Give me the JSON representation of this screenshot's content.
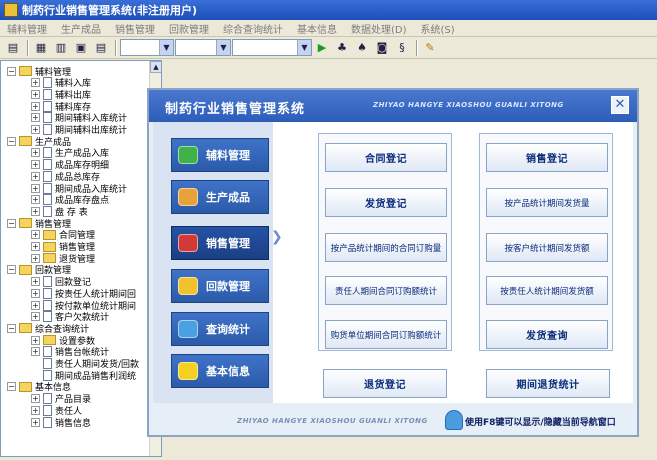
{
  "window": {
    "title": "制药行业销售管理系统(非注册用户)"
  },
  "menu": [
    "辅料管理",
    "生产成品",
    "销售管理",
    "回款管理",
    "综合查询统计",
    "基本信息",
    "数据处理(D)",
    "系统(S)"
  ],
  "tree": [
    {
      "text": "辅料管理",
      "level": 0,
      "kind": "folder",
      "exp": "minus"
    },
    {
      "text": "辅料入库",
      "level": 1,
      "kind": "doc",
      "exp": "plus"
    },
    {
      "text": "辅料出库",
      "level": 1,
      "kind": "doc",
      "exp": "plus"
    },
    {
      "text": "辅料库存",
      "level": 1,
      "kind": "doc",
      "exp": "plus"
    },
    {
      "text": "期间辅料入库统计",
      "level": 1,
      "kind": "doc",
      "exp": "plus"
    },
    {
      "text": "期间辅料出库统计",
      "level": 1,
      "kind": "doc",
      "exp": "plus"
    },
    {
      "text": "生产成品",
      "level": 0,
      "kind": "folder",
      "exp": "minus"
    },
    {
      "text": "生产成品入库",
      "level": 1,
      "kind": "doc",
      "exp": "plus"
    },
    {
      "text": "成品库存明细",
      "level": 1,
      "kind": "doc",
      "exp": "plus"
    },
    {
      "text": "成品总库存",
      "level": 1,
      "kind": "doc",
      "exp": "plus"
    },
    {
      "text": "期间成品入库统计",
      "level": 1,
      "kind": "doc",
      "exp": "plus"
    },
    {
      "text": "成品库存盘点",
      "level": 1,
      "kind": "doc",
      "exp": "plus"
    },
    {
      "text": "盘  存  表",
      "level": 1,
      "kind": "doc",
      "exp": "plus"
    },
    {
      "text": "销售管理",
      "level": 0,
      "kind": "folder",
      "exp": "minus"
    },
    {
      "text": "合同管理",
      "level": 1,
      "kind": "folder",
      "exp": "plus"
    },
    {
      "text": "销售管理",
      "level": 1,
      "kind": "folder",
      "exp": "plus"
    },
    {
      "text": "退货管理",
      "level": 1,
      "kind": "folder",
      "exp": "plus"
    },
    {
      "text": "回款管理",
      "level": 0,
      "kind": "folder",
      "exp": "minus"
    },
    {
      "text": "回款登记",
      "level": 1,
      "kind": "doc",
      "exp": "plus"
    },
    {
      "text": "按责任人统计期间回",
      "level": 1,
      "kind": "doc",
      "exp": "plus"
    },
    {
      "text": "按付款单位统计期间",
      "level": 1,
      "kind": "doc",
      "exp": "plus"
    },
    {
      "text": "客户欠款统计",
      "level": 1,
      "kind": "doc",
      "exp": "plus"
    },
    {
      "text": "综合查询统计",
      "level": 0,
      "kind": "folder",
      "exp": "minus"
    },
    {
      "text": "设置参数",
      "level": 1,
      "kind": "folder",
      "exp": "plus"
    },
    {
      "text": "销售台帐统计",
      "level": 1,
      "kind": "doc",
      "exp": "plus"
    },
    {
      "text": "责任人期间发货/回款",
      "level": 1,
      "kind": "doc",
      "exp": "none"
    },
    {
      "text": "期间成品销售利润统",
      "level": 1,
      "kind": "doc",
      "exp": "none"
    },
    {
      "text": "基本信息",
      "level": 0,
      "kind": "folder",
      "exp": "minus"
    },
    {
      "text": "产品目录",
      "level": 1,
      "kind": "doc",
      "exp": "plus"
    },
    {
      "text": "责任人",
      "level": 1,
      "kind": "doc",
      "exp": "plus"
    },
    {
      "text": "销售信息",
      "level": 1,
      "kind": "doc",
      "exp": "plus"
    }
  ],
  "panel": {
    "title": "制药行业销售管理系统",
    "subtitle_en": "ZHIYAO HANGYE XIAOSHOU GUANLI XITONG",
    "nav": [
      {
        "label": "辅料管理",
        "color": "#3fb24a"
      },
      {
        "label": "生产成品",
        "color": "#e8a23a"
      },
      {
        "label": "销售管理",
        "color": "#d23a3a"
      },
      {
        "label": "回款管理",
        "color": "#f2c12e"
      },
      {
        "label": "查询统计",
        "color": "#4aa0e0"
      },
      {
        "label": "基本信息",
        "color": "#f5d020"
      }
    ],
    "left_group": [
      "合同登记",
      "发货登记",
      "按产品统计期间的合同订购量",
      "责任人期间合同订购额统计",
      "购货单位期间合同订购额统计"
    ],
    "right_group": [
      "销售登记",
      "按产品统计期间发货量",
      "按客户统计期间发货额",
      "按责任人统计期间发货额",
      "发货查询"
    ],
    "bottom_left": "退货登记",
    "bottom_right": "期间退货统计",
    "footer_en": "ZHIYAO HANGYE XIAOSHOU GUANLI XITONG",
    "footer_hint": "使用F8键可以显示/隐藏当前导航窗口",
    "close": "✕"
  },
  "toolbar": {
    "icons": [
      "tree-icon",
      "grid-icon",
      "doc-icon",
      "image-icon",
      "list-icon",
      "play-icon",
      "find-icon",
      "print-icon",
      "preview-icon",
      "refresh-icon",
      "pen-icon"
    ]
  }
}
